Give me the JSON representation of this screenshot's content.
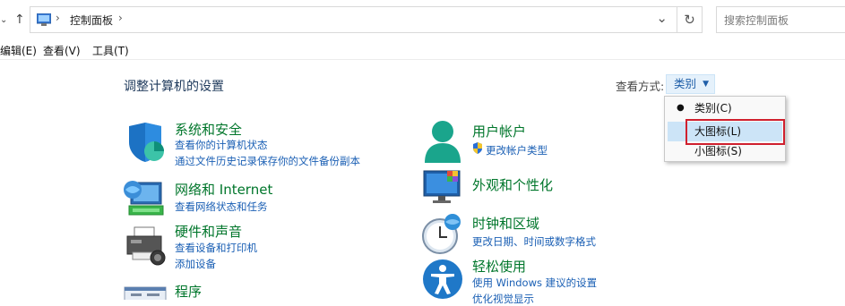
{
  "nav": {
    "back_down_icon": "chevron-down",
    "up_icon": "arrow-up",
    "breadcrumb_sep": "›",
    "breadcrumb_item": "控制面板",
    "history_dropdown_icon": "chevron-down",
    "refresh_icon": "refresh"
  },
  "search": {
    "placeholder": "搜索控制面板"
  },
  "menu": {
    "items": [
      "编辑(E)",
      "查看(V)",
      "工具(T)"
    ]
  },
  "main": {
    "heading": "调整计算机的设置",
    "view_by_label": "查看方式:",
    "view_by_value": "类别"
  },
  "view_menu": {
    "options": [
      "类别(C)",
      "大图标(L)",
      "小图标(S)"
    ],
    "checked_index": 0,
    "hover_index": 1,
    "highlight_color": "#d0202e"
  },
  "categories_left": [
    {
      "title": "系统和安全",
      "links": [
        "查看你的计算机状态",
        "通过文件历史记录保存你的文件备份副本"
      ]
    },
    {
      "title": "网络和 Internet",
      "links": [
        "查看网络状态和任务"
      ]
    },
    {
      "title": "硬件和声音",
      "links": [
        "查看设备和打印机",
        "添加设备"
      ]
    },
    {
      "title": "程序",
      "links": []
    }
  ],
  "categories_right": [
    {
      "title": "用户帐户",
      "links": [
        "更改帐户类型"
      ]
    },
    {
      "title": "外观和个性化",
      "links": []
    },
    {
      "title": "时钟和区域",
      "links": [
        "更改日期、时间或数字格式"
      ]
    },
    {
      "title": "轻松使用",
      "links": [
        "使用 Windows 建议的设置",
        "优化视觉显示"
      ]
    }
  ],
  "colors": {
    "category_title": "#00762b",
    "link": "#1a5fb4",
    "heading": "#1e395b"
  }
}
